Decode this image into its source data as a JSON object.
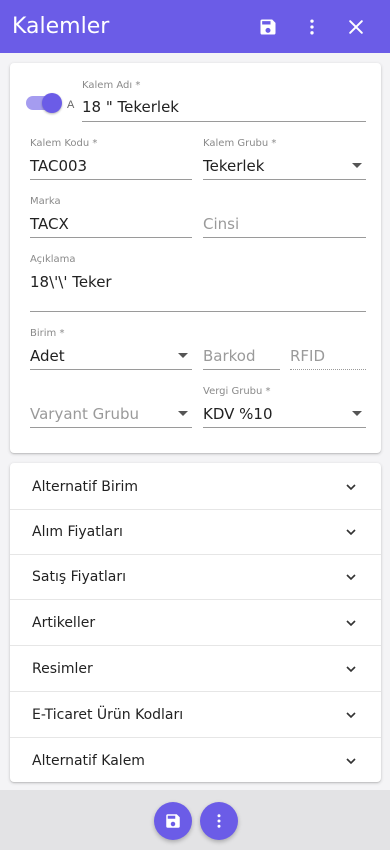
{
  "appbar": {
    "title": "Kalemler",
    "actions": [
      {
        "icon": "save-icon"
      },
      {
        "icon": "more-vertical-icon"
      },
      {
        "icon": "close-icon"
      }
    ],
    "color": "#6b5ce7"
  },
  "form": {
    "active_toggle": {
      "on": true,
      "tail_text": "A"
    },
    "kalem_adi": {
      "label": "Kalem Adı *",
      "value": "18 \" Tekerlek"
    },
    "kalem_kodu": {
      "label": "Kalem Kodu *",
      "value": "TAC003"
    },
    "kalem_grubu": {
      "label": "Kalem Grubu *",
      "value": "Tekerlek"
    },
    "marka": {
      "label": "Marka",
      "value": "TACX"
    },
    "cinsi": {
      "placeholder": "Cinsi"
    },
    "aciklama": {
      "label": "Açıklama",
      "value": "18\\'\\' Teker"
    },
    "birim": {
      "label": "Birim *",
      "value": "Adet"
    },
    "barkod": {
      "placeholder": "Barkod"
    },
    "rfid": {
      "placeholder": "RFID"
    },
    "varyant_grubu": {
      "placeholder": "Varyant Grubu"
    },
    "vergi_grubu": {
      "label": "Vergi Grubu *",
      "value": "KDV %10"
    }
  },
  "accordion": [
    {
      "label": "Alternatif Birim"
    },
    {
      "label": "Alım Fiyatları"
    },
    {
      "label": "Satış Fiyatları"
    },
    {
      "label": "Artikeller"
    },
    {
      "label": "Resimler"
    },
    {
      "label": "E-Ticaret Ürün Kodları"
    },
    {
      "label": "Alternatif Kalem"
    }
  ],
  "bottom_actions": [
    {
      "icon": "save-icon"
    },
    {
      "icon": "more-vertical-icon"
    }
  ]
}
